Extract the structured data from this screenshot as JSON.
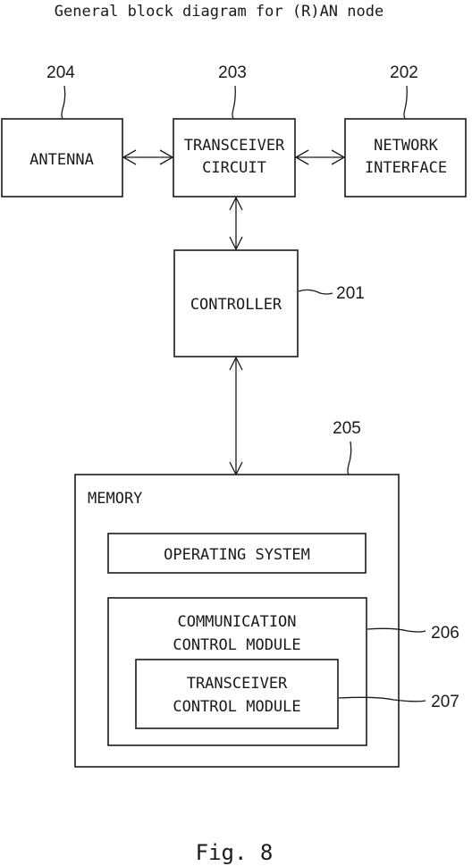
{
  "title": "General block diagram for (R)AN node",
  "figure_caption": "Fig. 8",
  "blocks": {
    "antenna": {
      "ref": "204",
      "lines": [
        "ANTENNA"
      ]
    },
    "transceiver_circuit": {
      "ref": "203",
      "lines": [
        "TRANSCEIVER",
        "CIRCUIT"
      ]
    },
    "network_interface": {
      "ref": "202",
      "lines": [
        "NETWORK",
        "INTERFACE"
      ]
    },
    "controller": {
      "ref": "201",
      "lines": [
        "CONTROLLER"
      ]
    },
    "memory": {
      "ref": "205",
      "lines": [
        "MEMORY"
      ]
    },
    "operating_system": {
      "lines": [
        "OPERATING SYSTEM"
      ]
    },
    "communication_control_module": {
      "ref": "206",
      "lines": [
        "COMMUNICATION",
        "CONTROL MODULE"
      ]
    },
    "transceiver_control_module": {
      "ref": "207",
      "lines": [
        "TRANSCEIVER",
        "CONTROL MODULE"
      ]
    }
  },
  "connections": [
    {
      "from": "antenna",
      "to": "transceiver_circuit",
      "direction": "bidirectional"
    },
    {
      "from": "transceiver_circuit",
      "to": "network_interface",
      "direction": "bidirectional"
    },
    {
      "from": "transceiver_circuit",
      "to": "controller",
      "direction": "bidirectional"
    },
    {
      "from": "controller",
      "to": "memory",
      "direction": "bidirectional"
    }
  ]
}
